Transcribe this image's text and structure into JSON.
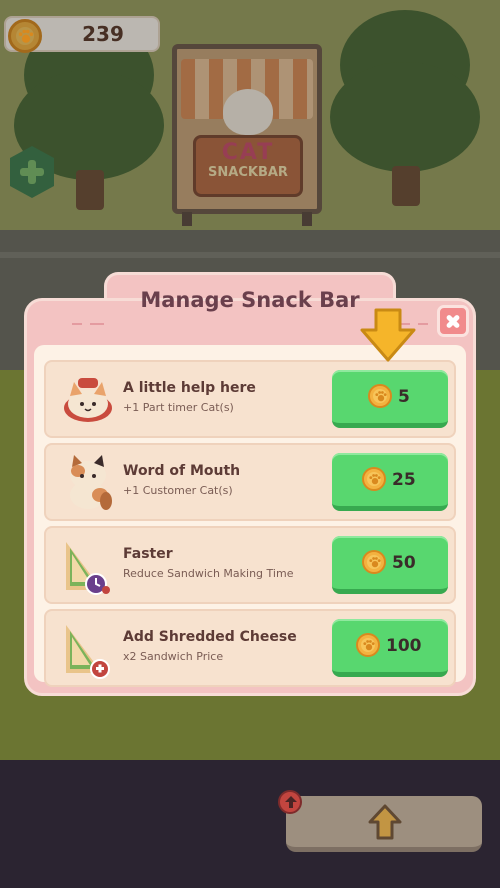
{
  "hud": {
    "coins": "239"
  },
  "shop_sign": {
    "line1": "CAT",
    "line2": "SNACKBAR"
  },
  "dialog": {
    "title": "Manage Snack Bar",
    "upgrades": [
      {
        "title": "A little help here",
        "description": "+1 Part timer Cat(s)",
        "cost": "5",
        "icon": "chef-cat-icon"
      },
      {
        "title": "Word of Mouth",
        "description": "+1 Customer Cat(s)",
        "cost": "25",
        "icon": "calico-cat-icon"
      },
      {
        "title": "Faster",
        "description": "Reduce Sandwich Making Time",
        "cost": "50",
        "icon": "sandwich-clock-icon"
      },
      {
        "title": "Add Shredded Cheese",
        "description": "x2 Sandwich Price",
        "cost": "100",
        "icon": "sandwich-plus-icon"
      }
    ]
  },
  "colors": {
    "buy_button": "#58d76f",
    "panel": "#f3c3c2",
    "coin": "#f3b240",
    "hint_arrow": "#f5b52a"
  }
}
